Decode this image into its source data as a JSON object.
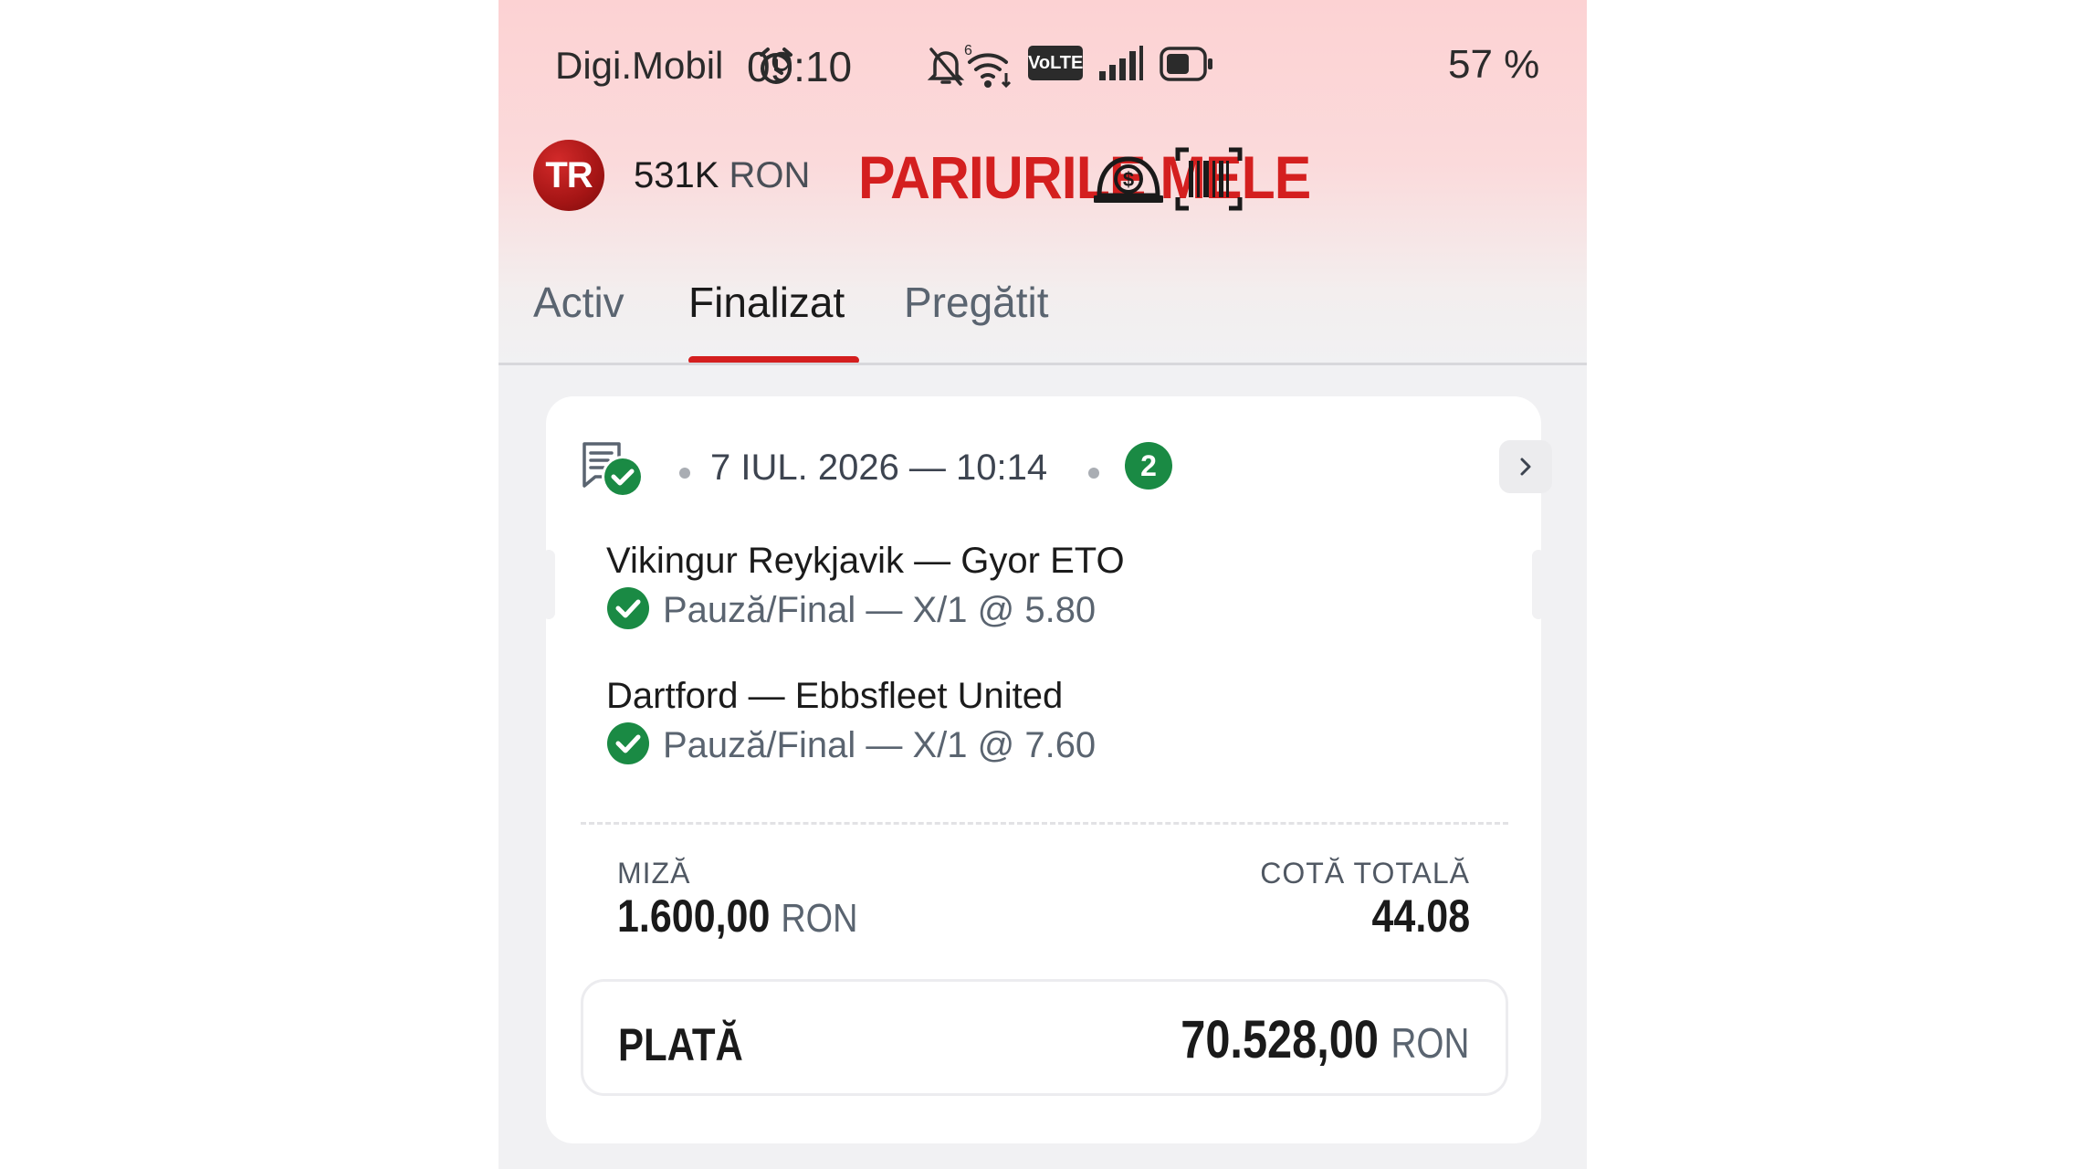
{
  "status_bar": {
    "carrier": "Digi.Mobil",
    "time": "09:10",
    "volte": "VoLTE",
    "battery": "57 %"
  },
  "header": {
    "avatar_initials": "TR",
    "balance_amount": "531K",
    "balance_currency": "RON",
    "title": "PARIURILE MELE",
    "icons": [
      "money-icon",
      "barcode-scan-icon"
    ]
  },
  "tabs": [
    {
      "label": "Activ",
      "active": false
    },
    {
      "label": "Finalizat",
      "active": true
    },
    {
      "label": "Pregătit",
      "active": false
    }
  ],
  "ticket": {
    "datetime": "7 IUL. 2026 — 10:14",
    "selections_count": "2",
    "events": [
      {
        "match": "Vikingur Reykjavik — Gyor ETO",
        "market": "Pauză/Final — X/1 @ 5.80",
        "status": "won"
      },
      {
        "match": "Dartford — Ebbsfleet United",
        "market": "Pauză/Final — X/1 @ 7.60",
        "status": "won"
      }
    ],
    "stake_label": "MIZĂ",
    "stake_value": "1.600,00",
    "stake_currency": "RON",
    "total_odds_label": "COTĂ TOTALĂ",
    "total_odds_value": "44.08",
    "payout_label": "PLATĂ",
    "payout_value": "70.528,00",
    "payout_currency": "RON"
  },
  "colors": {
    "brand_red": "#d41f1f",
    "win_green": "#1a8a44",
    "header_gradient_top": "#fcd2d3"
  }
}
